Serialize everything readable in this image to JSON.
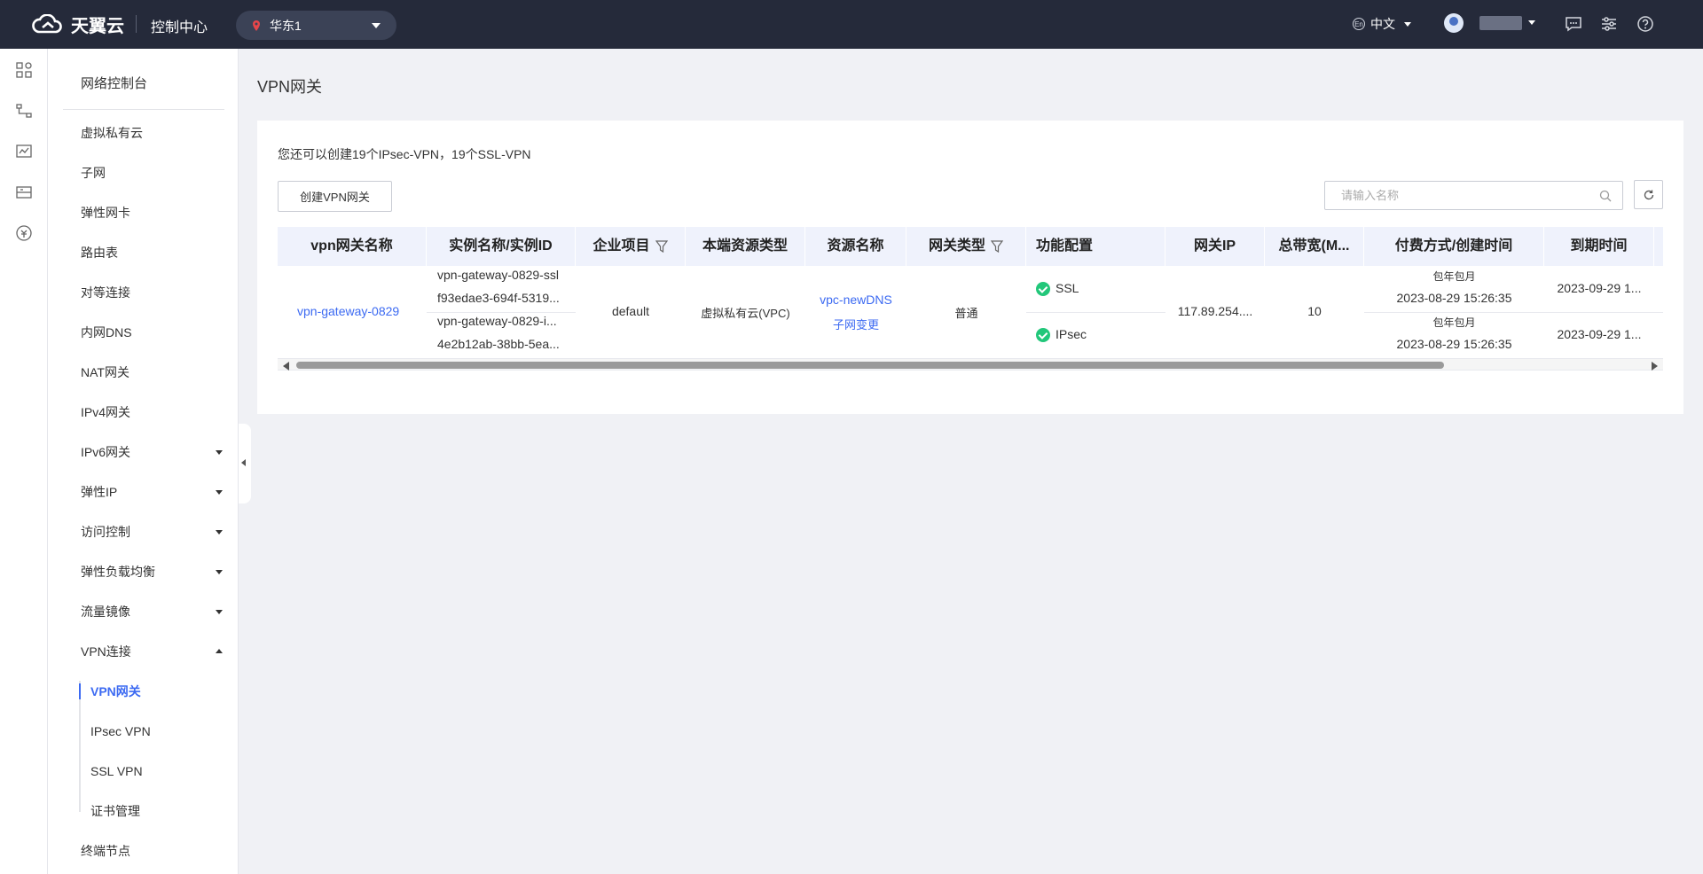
{
  "topbar": {
    "brand": "天翼云",
    "console_title": "控制中心",
    "region": "华东1",
    "language": "中文",
    "language_icon_text": "En"
  },
  "sidebar": {
    "title": "网络控制台",
    "items": [
      {
        "label": "虚拟私有云"
      },
      {
        "label": "子网"
      },
      {
        "label": "弹性网卡"
      },
      {
        "label": "路由表"
      },
      {
        "label": "对等连接"
      },
      {
        "label": "内网DNS"
      },
      {
        "label": "NAT网关"
      },
      {
        "label": "IPv4网关"
      },
      {
        "label": "IPv6网关"
      },
      {
        "label": "弹性IP"
      },
      {
        "label": "访问控制"
      },
      {
        "label": "弹性负载均衡"
      },
      {
        "label": "流量镜像"
      },
      {
        "label": "VPN连接"
      }
    ],
    "vpn_sub": [
      {
        "label": "VPN网关"
      },
      {
        "label": "IPsec VPN"
      },
      {
        "label": "SSL VPN"
      },
      {
        "label": "证书管理"
      }
    ],
    "last_item": "终端节点"
  },
  "main": {
    "page_title": "VPN网关",
    "quota_text": "您还可以创建19个IPsec-VPN，19个SSL-VPN",
    "create_button": "创建VPN网关",
    "search_placeholder": "请输入名称"
  },
  "table": {
    "headers": [
      "vpn网关名称",
      "实例名称/实例ID",
      "企业项目",
      "本端资源类型",
      "资源名称",
      "网关类型",
      "功能配置",
      "网关IP",
      "总带宽(M...",
      "付费方式/创建时间",
      "到期时间"
    ],
    "row": {
      "gateway_name": "vpn-gateway-0829",
      "instances": [
        {
          "name": "vpn-gateway-0829-ssl",
          "id": "f93edae3-694f-5319..."
        },
        {
          "name": "vpn-gateway-0829-i...",
          "id": "4e2b12ab-38bb-5ea..."
        }
      ],
      "enterprise_project": "default",
      "local_resource_type": "虚拟私有云(VPC)",
      "resource_name": "vpc-newDNS",
      "resource_action": "子网变更",
      "gateway_type": "普通",
      "features": [
        {
          "label": "SSL",
          "status_color": "#22c77a"
        },
        {
          "label": "IPsec",
          "status_color": "#22c77a"
        }
      ],
      "gateway_ip": "117.89.254....",
      "bandwidth": "10",
      "billing": [
        {
          "mode": "包年包月",
          "created": "2023-08-29 15:26:35"
        },
        {
          "mode": "包年包月",
          "created": "2023-08-29 15:26:35"
        }
      ],
      "expiry": [
        "2023-09-29 1...",
        "2023-09-29 1..."
      ]
    }
  },
  "colors": {
    "topbar_bg": "#252a3a",
    "accent": "#3c6af2",
    "success": "#22c77a",
    "table_header_bg": "#eff2fc"
  }
}
